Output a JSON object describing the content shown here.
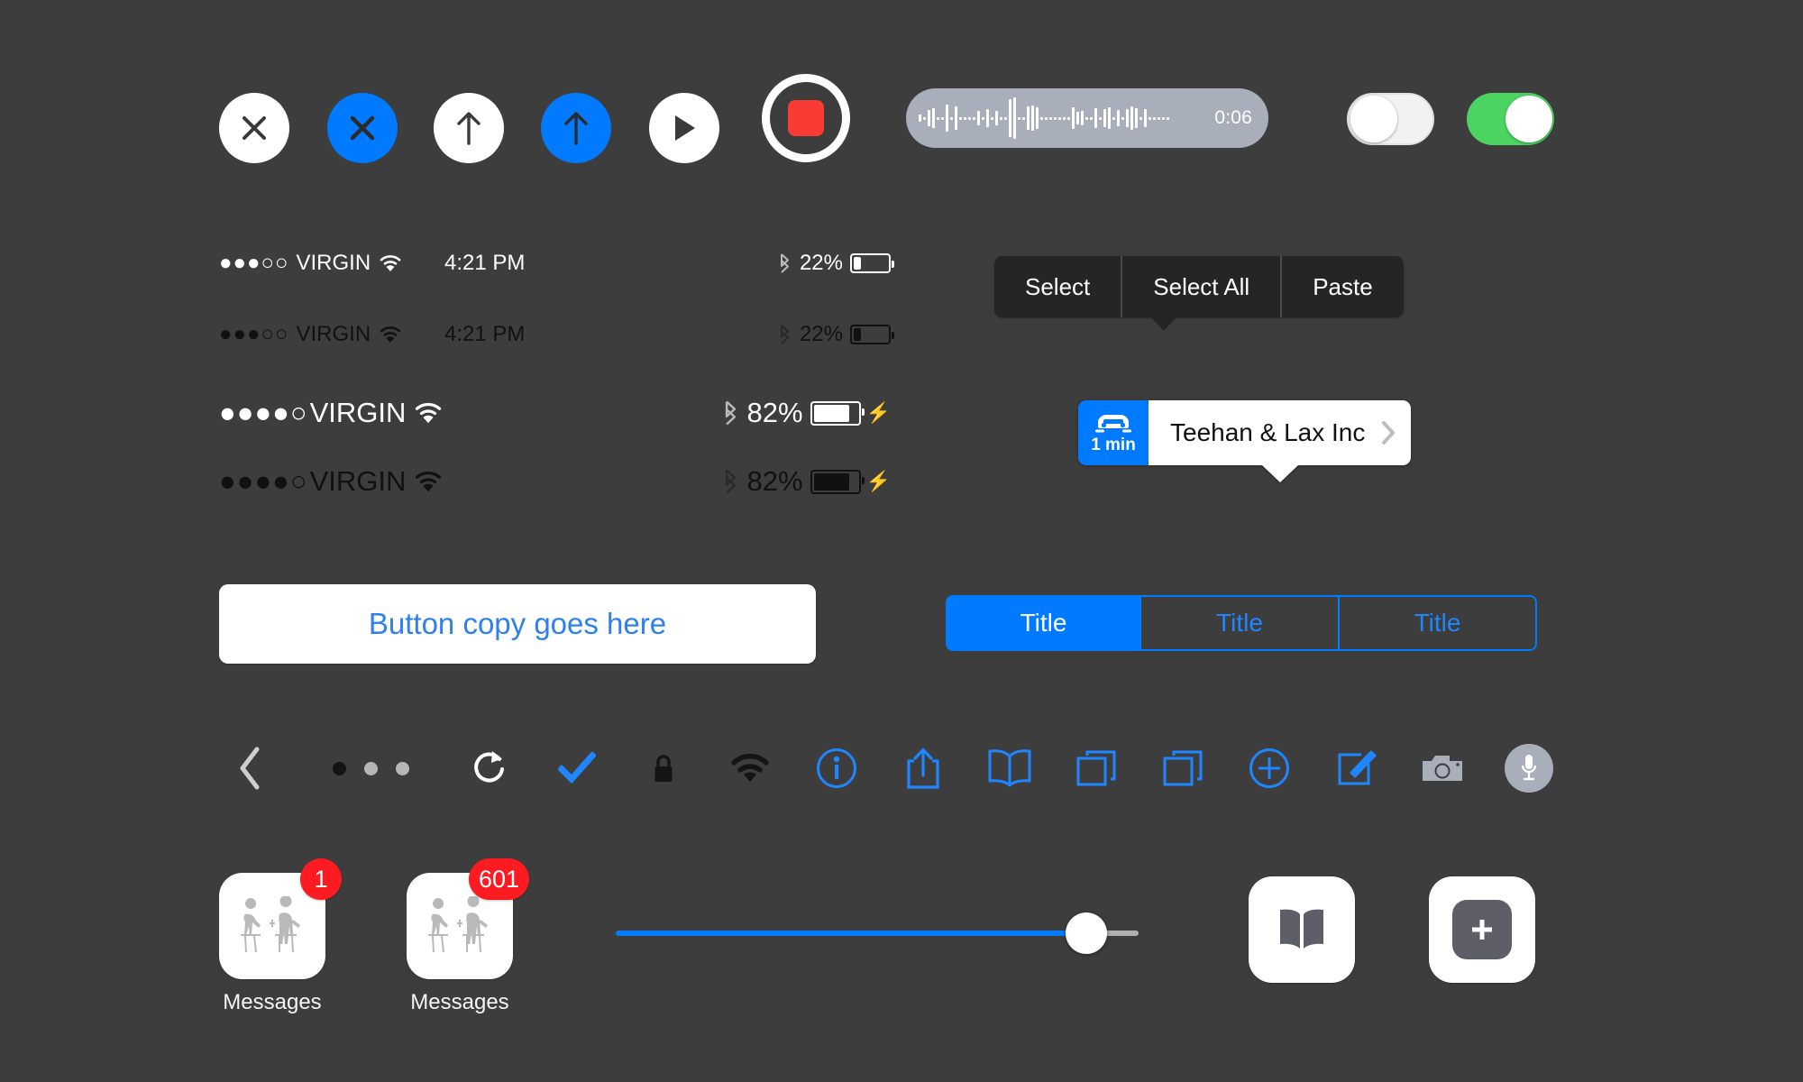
{
  "meta": {
    "background_color": "#3d3d3d",
    "accent_blue": "#007aff",
    "accent_green": "#4cd462",
    "accent_red": "#fc1b20",
    "record_red": "#f93b34"
  },
  "action_buttons": [
    {
      "name": "close-button-white",
      "icon": "close-icon",
      "style": "white"
    },
    {
      "name": "close-button-blue",
      "icon": "close-icon",
      "style": "blue"
    },
    {
      "name": "upload-button-white",
      "icon": "arrow-up-icon",
      "style": "white"
    },
    {
      "name": "upload-button-blue",
      "icon": "arrow-up-icon",
      "style": "blue"
    },
    {
      "name": "play-button",
      "icon": "play-icon",
      "style": "white"
    }
  ],
  "record_button": {
    "label_hidden": "record",
    "icon": "stop-square-icon"
  },
  "voice_memo": {
    "duration": "0:06",
    "waveform": [
      8,
      3,
      18,
      22,
      3,
      3,
      30,
      3,
      26,
      3,
      3,
      3,
      3,
      16,
      3,
      20,
      3,
      16,
      3,
      3,
      42,
      46,
      3,
      3,
      26,
      28,
      24,
      3,
      3,
      3,
      3,
      3,
      3,
      3,
      24,
      14,
      16,
      3,
      3,
      22,
      3,
      20,
      24,
      3,
      18,
      3,
      20,
      26,
      22,
      3,
      20,
      3,
      3,
      3,
      3,
      3
    ]
  },
  "toggles": [
    {
      "name": "toggle-off",
      "state": "off"
    },
    {
      "name": "toggle-on",
      "state": "on"
    }
  ],
  "status_bars": [
    {
      "variant": "light",
      "size": "small",
      "signal_dots": "●●●○○",
      "carrier": "VIRGIN",
      "wifi": true,
      "time": "4:21 PM",
      "bluetooth": true,
      "battery_percent": "22%",
      "battery_level": 22,
      "charging": false
    },
    {
      "variant": "dark",
      "size": "small",
      "signal_dots": "●●●○○",
      "carrier": "VIRGIN",
      "wifi": true,
      "time": "4:21 PM",
      "bluetooth": true,
      "battery_percent": "22%",
      "battery_level": 22,
      "charging": false
    },
    {
      "variant": "light",
      "size": "large",
      "signal_dots": "●●●●○",
      "carrier": "VIRGIN",
      "wifi": true,
      "time": "",
      "bluetooth": true,
      "battery_percent": "82%",
      "battery_level": 82,
      "charging": true
    },
    {
      "variant": "dark",
      "size": "large",
      "signal_dots": "●●●●○",
      "carrier": "VIRGIN",
      "wifi": true,
      "time": "",
      "bluetooth": true,
      "battery_percent": "82%",
      "battery_level": 82,
      "charging": true
    }
  ],
  "edit_menu": {
    "items": [
      {
        "label": "Select"
      },
      {
        "label": "Select All"
      },
      {
        "label": "Paste"
      }
    ]
  },
  "map_callout": {
    "eta": "1 min",
    "eta_icon": "car-icon",
    "title": "Teehan & Lax Inc",
    "chevron_icon": "chevron-right-icon"
  },
  "primary_button": {
    "label": "Button copy goes here"
  },
  "segmented_control": {
    "segments": [
      {
        "label": "Title",
        "selected": true
      },
      {
        "label": "Title",
        "selected": false
      },
      {
        "label": "Title",
        "selected": false
      }
    ]
  },
  "icon_strip": [
    {
      "name": "back-chevron-icon",
      "color": "#cfcfcf"
    },
    {
      "name": "page-dots",
      "dots": [
        "active",
        "idle",
        "idle"
      ]
    },
    {
      "name": "refresh-icon",
      "color": "#ffffff"
    },
    {
      "name": "checkmark-icon",
      "color": "#1f86ff"
    },
    {
      "name": "lock-icon",
      "color": "#141414"
    },
    {
      "name": "wifi-icon",
      "color": "#141414"
    },
    {
      "name": "info-circle-icon",
      "color": "#1f86ff"
    },
    {
      "name": "share-icon",
      "color": "#1f86ff"
    },
    {
      "name": "open-book-icon",
      "color": "#1f86ff"
    },
    {
      "name": "tabs-icon",
      "color": "#1f86ff"
    },
    {
      "name": "pages-icon",
      "color": "#1f86ff"
    },
    {
      "name": "plus-circle-icon",
      "color": "#1f86ff"
    },
    {
      "name": "compose-icon",
      "color": "#1f86ff"
    },
    {
      "name": "camera-icon",
      "color": "#a8aeba"
    },
    {
      "name": "microphone-icon",
      "color": "#ffffff"
    }
  ],
  "app_icons": [
    {
      "label": "Messages",
      "badge": "1",
      "icon": "messages-icon"
    },
    {
      "label": "Messages",
      "badge": "601",
      "icon": "messages-icon"
    }
  ],
  "slider": {
    "value_percent": 90
  },
  "tiles": [
    {
      "name": "ibooks-tile",
      "icon": "book-filled-icon"
    },
    {
      "name": "add-tile",
      "icon": "plus-square-icon"
    }
  ]
}
